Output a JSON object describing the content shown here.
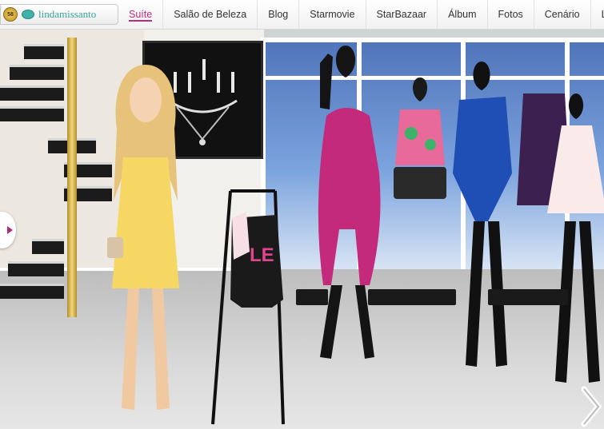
{
  "user": {
    "level": "58",
    "username": "lindamissanto"
  },
  "nav": {
    "items": [
      {
        "label": "Suíte",
        "active": true
      },
      {
        "label": "Salão de Beleza",
        "active": false
      },
      {
        "label": "Blog",
        "active": false
      },
      {
        "label": "Starmovie",
        "active": false
      },
      {
        "label": "StarBazaar",
        "active": false
      },
      {
        "label": "Álbum",
        "active": false
      },
      {
        "label": "Fotos",
        "active": false
      },
      {
        "label": "Cenário",
        "active": false
      },
      {
        "label": "L",
        "active": false
      }
    ]
  },
  "scene": {
    "shirt_print": "LE",
    "accent_color": "#c2287d",
    "icons": [
      "level-badge-icon",
      "diamond-icon",
      "arrow-left-icon",
      "arrow-right-icon"
    ]
  }
}
